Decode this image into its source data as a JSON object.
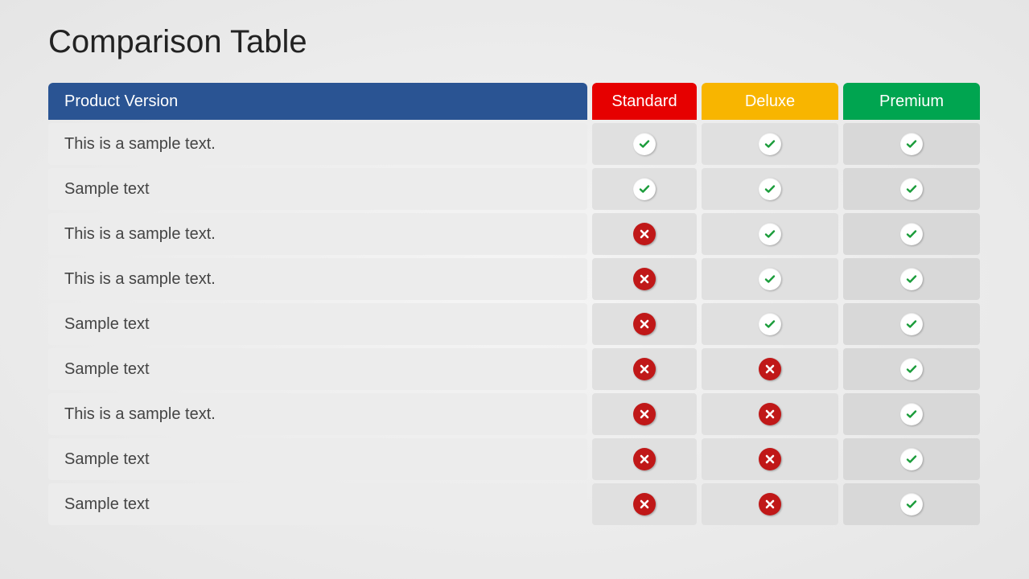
{
  "title": "Comparison Table",
  "chart_data": {
    "type": "table",
    "title": "Comparison Table",
    "headers": {
      "product": "Product Version",
      "columns": [
        "Standard",
        "Deluxe",
        "Premium"
      ]
    },
    "rows": [
      {
        "label": "This is a sample text.",
        "values": [
          true,
          true,
          true
        ]
      },
      {
        "label": "Sample text",
        "values": [
          true,
          true,
          true
        ]
      },
      {
        "label": "This is a sample text.",
        "values": [
          false,
          true,
          true
        ]
      },
      {
        "label": "This is a sample text.",
        "values": [
          false,
          true,
          true
        ]
      },
      {
        "label": "Sample text",
        "values": [
          false,
          true,
          true
        ]
      },
      {
        "label": "Sample text",
        "values": [
          false,
          false,
          true
        ]
      },
      {
        "label": "This is a sample text.",
        "values": [
          false,
          false,
          true
        ]
      },
      {
        "label": "Sample text",
        "values": [
          false,
          false,
          true
        ]
      },
      {
        "label": "Sample text",
        "values": [
          false,
          false,
          true
        ]
      }
    ]
  },
  "colors": {
    "product_header": "#2a5493",
    "standard_header": "#e60000",
    "deluxe_header": "#f8b500",
    "premium_header": "#00a550",
    "check_mark": "#1a9c3a",
    "cross_bg": "#c01818"
  }
}
